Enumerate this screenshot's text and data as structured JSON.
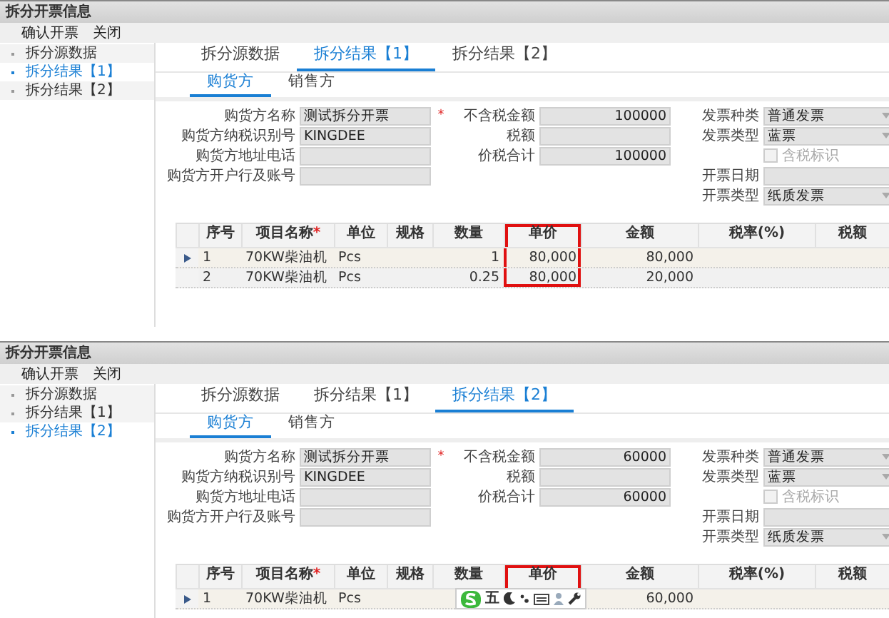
{
  "windows": [
    {
      "title": "拆分开票信息",
      "toolbar": [
        {
          "label": "确认开票"
        },
        {
          "label": "关闭"
        }
      ],
      "sidebar": [
        {
          "label": "拆分源数据",
          "selected": false
        },
        {
          "label": "拆分结果【1】",
          "selected": true
        },
        {
          "label": "拆分结果【2】",
          "selected": false
        }
      ],
      "tabs": [
        {
          "label": "拆分源数据",
          "selected": false
        },
        {
          "label": "拆分结果【1】",
          "selected": true
        },
        {
          "label": "拆分结果【2】",
          "selected": false
        }
      ],
      "subtabs": [
        {
          "label": "购货方",
          "selected": true
        },
        {
          "label": "销售方",
          "selected": false
        }
      ],
      "buyer_fields": [
        {
          "kind": "text",
          "label": "购货方名称",
          "value": "测试拆分开票",
          "required_mark": "*"
        },
        {
          "kind": "text",
          "label": "购货方纳税识别号",
          "value": "KINGDEE"
        },
        {
          "kind": "text",
          "label": "购货方地址电话"
        },
        {
          "kind": "text",
          "label": "购货方开户行及账号"
        }
      ],
      "amount_fields": [
        {
          "kind": "number",
          "label": "不含税金额",
          "value": "100000"
        },
        {
          "kind": "number",
          "label": "税额"
        },
        {
          "kind": "number",
          "label": "价税合计",
          "value": "100000"
        }
      ],
      "invoice_fields": [
        {
          "kind": "select",
          "label": "发票种类",
          "value": "普通发票"
        },
        {
          "kind": "select",
          "label": "发票类型",
          "value": "蓝票"
        },
        {
          "kind": "checkbox",
          "label": "含税标识",
          "checked": false,
          "disabled": true
        },
        {
          "kind": "text",
          "label": "开票日期"
        },
        {
          "kind": "select",
          "label": "开票类型",
          "value": "纸质发票"
        }
      ],
      "grid": {
        "columns": [
          {
            "label": "序号",
            "kind": "text",
            "highlighted": false
          },
          {
            "label": "项目名称",
            "required_mark": "*",
            "kind": "text",
            "highlighted": false
          },
          {
            "label": "单位",
            "kind": "text",
            "highlighted": false
          },
          {
            "label": "规格",
            "kind": "text",
            "highlighted": false
          },
          {
            "label": "数量",
            "kind": "number",
            "highlighted": false
          },
          {
            "label": "单价",
            "kind": "number",
            "highlighted": true
          },
          {
            "label": "金额",
            "kind": "number",
            "highlighted": false
          },
          {
            "label": "税率(%)",
            "kind": "number",
            "highlighted": false
          },
          {
            "label": "税额",
            "kind": "number",
            "highlighted": false
          }
        ],
        "rows": [
          {
            "selected": true,
            "cells": [
              "1",
              "70KW柴油机",
              "Pcs",
              null,
              "1",
              "80,000",
              "80,000",
              null,
              null
            ]
          },
          {
            "selected": false,
            "cells": [
              "2",
              "70KW柴油机",
              "Pcs",
              null,
              "0.25",
              "80,000",
              "20,000",
              null,
              null
            ]
          }
        ]
      }
    },
    {
      "title": "拆分开票信息",
      "toolbar": [
        {
          "label": "确认开票"
        },
        {
          "label": "关闭"
        }
      ],
      "sidebar": [
        {
          "label": "拆分源数据",
          "selected": false
        },
        {
          "label": "拆分结果【1】",
          "selected": false
        },
        {
          "label": "拆分结果【2】",
          "selected": true
        }
      ],
      "tabs": [
        {
          "label": "拆分源数据",
          "selected": false
        },
        {
          "label": "拆分结果【1】",
          "selected": false
        },
        {
          "label": "拆分结果【2】",
          "selected": true
        }
      ],
      "subtabs": [
        {
          "label": "购货方",
          "selected": true
        },
        {
          "label": "销售方",
          "selected": false
        }
      ],
      "buyer_fields": [
        {
          "kind": "text",
          "label": "购货方名称",
          "value": "测试拆分开票",
          "required_mark": "*"
        },
        {
          "kind": "text",
          "label": "购货方纳税识别号",
          "value": "KINGDEE"
        },
        {
          "kind": "text",
          "label": "购货方地址电话"
        },
        {
          "kind": "text",
          "label": "购货方开户行及账号"
        }
      ],
      "amount_fields": [
        {
          "kind": "number",
          "label": "不含税金额",
          "value": "60000"
        },
        {
          "kind": "number",
          "label": "税额"
        },
        {
          "kind": "number",
          "label": "价税合计",
          "value": "60000"
        }
      ],
      "invoice_fields": [
        {
          "kind": "select",
          "label": "发票种类",
          "value": "普通发票"
        },
        {
          "kind": "select",
          "label": "发票类型",
          "value": "蓝票"
        },
        {
          "kind": "checkbox",
          "label": "含税标识",
          "checked": false,
          "disabled": true
        },
        {
          "kind": "text",
          "label": "开票日期"
        },
        {
          "kind": "select",
          "label": "开票类型",
          "value": "纸质发票"
        }
      ],
      "grid": {
        "columns": [
          {
            "label": "序号",
            "kind": "text",
            "highlighted": false
          },
          {
            "label": "项目名称",
            "required_mark": "*",
            "kind": "text",
            "highlighted": false
          },
          {
            "label": "单位",
            "kind": "text",
            "highlighted": false
          },
          {
            "label": "规格",
            "kind": "text",
            "highlighted": false
          },
          {
            "label": "数量",
            "kind": "number",
            "highlighted": false
          },
          {
            "label": "单价",
            "kind": "number",
            "highlighted": true
          },
          {
            "label": "金额",
            "kind": "number",
            "highlighted": false
          },
          {
            "label": "税率(%)",
            "kind": "number",
            "highlighted": false
          },
          {
            "label": "税额",
            "kind": "number",
            "highlighted": false
          }
        ],
        "rows": [
          {
            "selected": true,
            "cells": [
              "1",
              "70KW柴油机",
              "Pcs",
              null,
              null,
              null,
              "60,000",
              null,
              null
            ]
          }
        ]
      },
      "ime_toolbar": {
        "mode": "五"
      }
    }
  ]
}
